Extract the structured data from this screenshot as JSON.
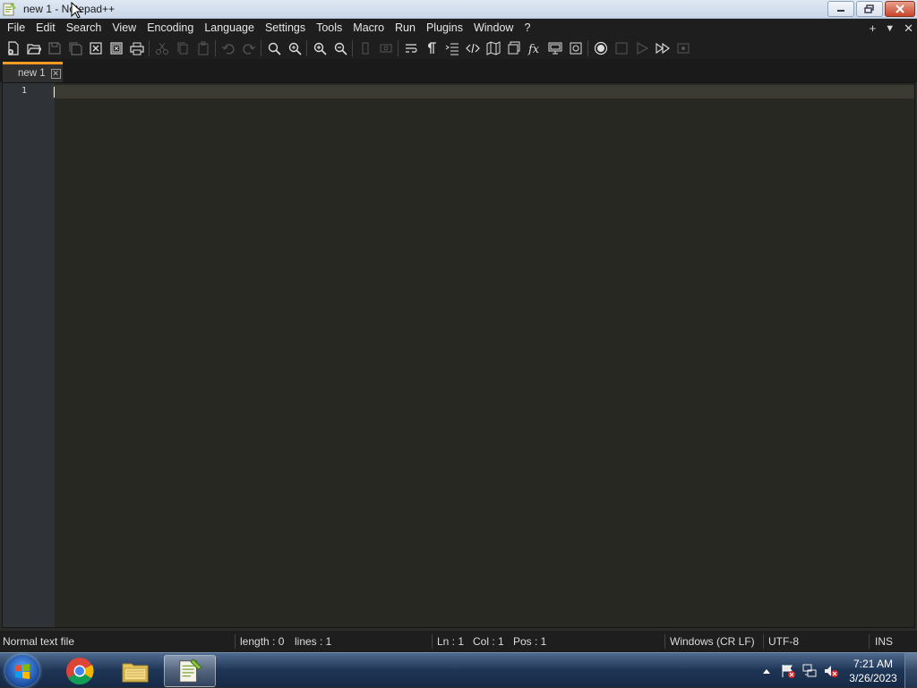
{
  "window": {
    "title": "new 1 - Notepad++"
  },
  "menu": {
    "items": [
      "File",
      "Edit",
      "Search",
      "View",
      "Encoding",
      "Language",
      "Settings",
      "Tools",
      "Macro",
      "Run",
      "Plugins",
      "Window",
      "?"
    ],
    "right_icons": [
      "add-icon",
      "dropdown-icon",
      "close-icon"
    ]
  },
  "toolbar": {
    "icons": [
      "new-file-icon",
      "open-file-icon",
      "save-icon",
      "save-all-icon",
      "close-icon",
      "close-all-icon",
      "print-icon",
      "cut-icon",
      "copy-icon",
      "paste-icon",
      "undo-icon",
      "redo-icon",
      "find-icon",
      "replace-icon",
      "zoom-in-icon",
      "zoom-out-icon",
      "sync-vertical-icon",
      "sync-horizontal-icon",
      "word-wrap-icon",
      "show-all-chars-icon",
      "indent-guide-icon",
      "xml-tag-icon",
      "document-map-icon",
      "function-list-icon",
      "folder-as-workspace-icon",
      "monitoring-icon",
      "record-macro-icon",
      "stop-record-icon",
      "play-macro-icon",
      "run-macro-multiple-icon",
      "save-macro-icon"
    ]
  },
  "tabs": [
    {
      "label": "new 1",
      "close_symbol": "✕"
    }
  ],
  "editor": {
    "line_numbers": [
      "1"
    ]
  },
  "statusbar": {
    "file_type": "Normal text file",
    "length": "length : 0",
    "lines": "lines : 1",
    "ln": "Ln : 1",
    "col": "Col : 1",
    "pos": "Pos : 1",
    "eol": "Windows (CR LF)",
    "encoding": "UTF-8",
    "mode": "INS"
  },
  "taskbar": {
    "apps": [
      "windows-start-icon",
      "chrome-icon",
      "file-explorer-icon",
      "notepadpp-icon"
    ],
    "clock_time": "7:21 AM",
    "clock_date": "3/26/2023"
  },
  "colors": {
    "accent_tab": "#f59a23",
    "editor_bg": "#272822"
  }
}
